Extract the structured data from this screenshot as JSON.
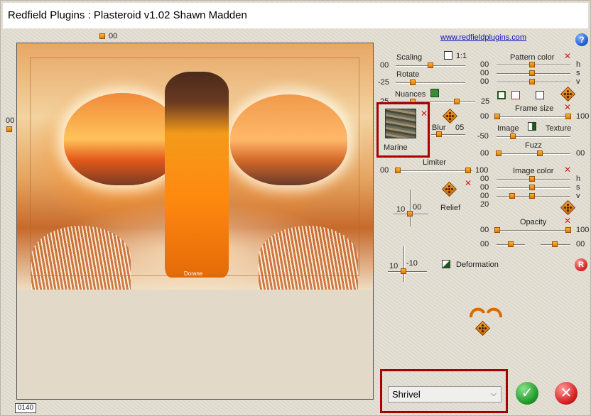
{
  "title": "Redfield Plugins : Plasteroid v1.02   Shawn Madden",
  "link": "www.redfieldplugins.com",
  "preview": {
    "top_value": "00",
    "left_value": "00",
    "zoom": "0140",
    "watermark": "Dorane"
  },
  "left_col": {
    "scaling_label": "Scaling",
    "ratio_label": "1:1",
    "scaling_value": "00",
    "rotate_label": "Rotate",
    "rotate_value": "-25",
    "nuances_label": "Nuances",
    "nuances_left": "25",
    "nuances_right": "25",
    "texture_name": "Marine",
    "blur_label": "Blur",
    "blur_value": "05",
    "limiter_label": "Limiter",
    "limiter_left": "00",
    "limiter_right": "100",
    "relief_label": "Relief",
    "relief_x": "10",
    "relief_y": "00",
    "deform_x": "10",
    "deform_y": "-10",
    "deformation_label": "Deformation"
  },
  "right_col": {
    "pattern_color_label": "Pattern color",
    "pattern_vals": [
      "00",
      "00",
      "00"
    ],
    "hsv": [
      "h",
      "s",
      "v"
    ],
    "frame_size_label": "Frame size",
    "frame_left": "00",
    "frame_right": "100",
    "image_label": "Image",
    "texture_label": "Texture",
    "image_value": "-50",
    "fuzz_label": "Fuzz",
    "fuzz_left": "00",
    "fuzz_right": "00",
    "image_color_label": "Image color",
    "image_color_vals": [
      "00",
      "00",
      "00"
    ],
    "image_color_extra": "20",
    "opacity_label": "Opacity",
    "opacity_left": "00",
    "opacity_right": "100",
    "opacity2_left": "00",
    "opacity2_right": "00"
  },
  "preset": {
    "selected": "Shrivel"
  },
  "icons": {
    "help": "?",
    "reset": "R",
    "ok": "✓",
    "cancel": "✕",
    "close_x": "✕",
    "chevron": "⌵"
  }
}
